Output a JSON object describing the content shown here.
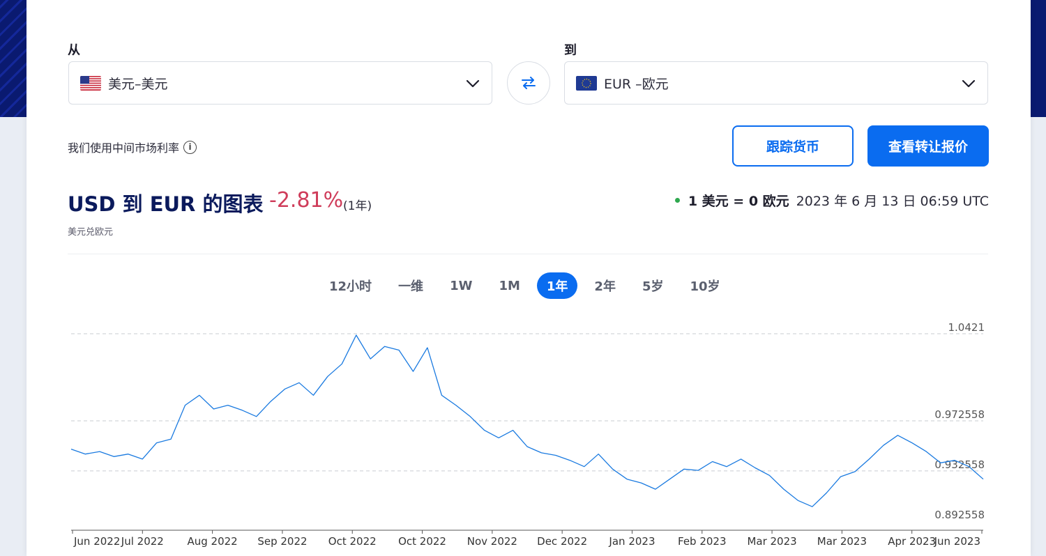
{
  "converter": {
    "from_label": "从",
    "to_label": "到",
    "from_value": "美元–美元",
    "to_value": "EUR –欧元",
    "from_flag": "us-flag-icon",
    "to_flag": "eu-flag-icon"
  },
  "note": "我们使用中间市场利率",
  "buttons": {
    "track": "跟踪货币",
    "quote": "查看转让报价"
  },
  "header": {
    "title": "USD 到 EUR 的图表",
    "change": "-2.81%",
    "period": "(1年)",
    "subtitle": "美元兑欧元",
    "rate": "1 美元 = 0 欧元",
    "timestamp": "2023 年 6 月 13 日 06:59 UTC"
  },
  "tabs": [
    "12小时",
    "一维",
    "1W",
    "1M",
    "1年",
    "2年",
    "5岁",
    "10岁"
  ],
  "active_tab": "1年",
  "colors": {
    "accent": "#0a6cf0",
    "title": "#0b1a5c",
    "negative": "#cf3c5a",
    "line": "#1a7ae0",
    "live_dot": "#2fa84f"
  },
  "chart_data": {
    "type": "line",
    "x_labels": [
      "Jun 2022",
      "Jul 2022",
      "Aug 2022",
      "Sep 2022",
      "Oct 2022",
      "Oct 2022",
      "Nov 2022",
      "Dec 2022",
      "Jan 2023",
      "Feb 2023",
      "Mar 2023",
      "Mar 2023",
      "Apr 2023",
      "Jun 2023"
    ],
    "y_ticks": [
      1.0421,
      0.972558,
      0.932558,
      0.892558
    ],
    "y_tick_labels": [
      "1.0421",
      "0.972558",
      "0.932558",
      "0.892558"
    ],
    "ylim": [
      0.888,
      1.0421
    ],
    "series": [
      {
        "values": [
          0.95,
          0.946,
          0.948,
          0.944,
          0.946,
          0.942,
          0.955,
          0.958,
          0.985,
          0.993,
          0.982,
          0.985,
          0.981,
          0.976,
          0.988,
          0.998,
          1.003,
          0.993,
          1.008,
          1.018,
          1.041,
          1.022,
          1.032,
          1.029,
          1.012,
          1.031,
          0.993,
          0.985,
          0.976,
          0.965,
          0.959,
          0.965,
          0.952,
          0.947,
          0.945,
          0.941,
          0.936,
          0.946,
          0.934,
          0.926,
          0.923,
          0.918,
          0.926,
          0.934,
          0.933,
          0.94,
          0.936,
          0.942,
          0.935,
          0.929,
          0.918,
          0.909,
          0.904,
          0.915,
          0.928,
          0.932,
          0.942,
          0.953,
          0.961,
          0.955,
          0.948,
          0.939,
          0.941,
          0.936,
          0.926
        ]
      }
    ]
  }
}
